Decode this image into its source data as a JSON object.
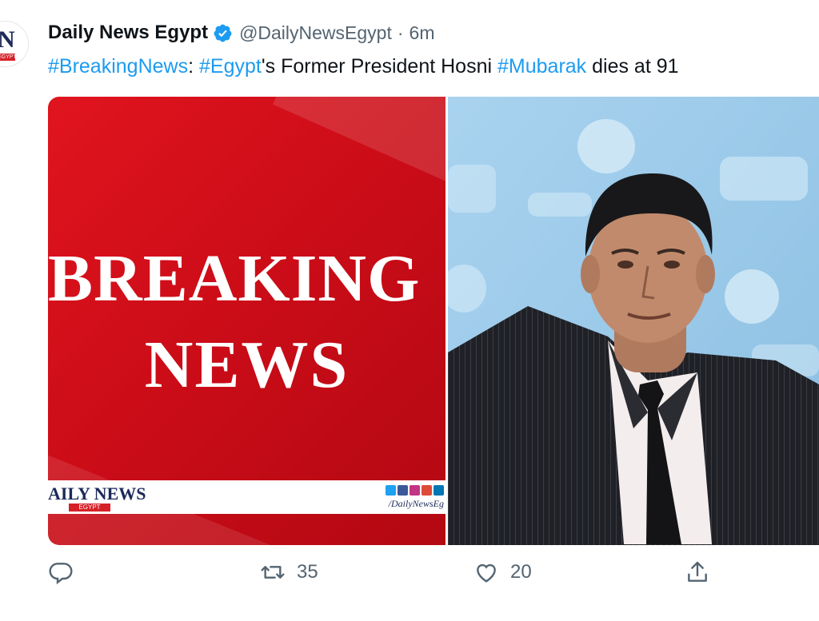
{
  "tweet": {
    "author_name": "Daily News Egypt",
    "handle": "@DailyNewsEgypt",
    "separator": "·",
    "time": "6m",
    "text": [
      {
        "text": "#BreakingNews",
        "hashtag": true
      },
      {
        "text": ": ",
        "hashtag": false
      },
      {
        "text": "#Egypt",
        "hashtag": true
      },
      {
        "text": "'s Former President Hosni ",
        "hashtag": false
      },
      {
        "text": "#Mubarak",
        "hashtag": true
      },
      {
        "text": " dies at 91",
        "hashtag": false
      }
    ]
  },
  "avatar": {
    "letter": "N",
    "strip": "EGYPT"
  },
  "media": {
    "left_image": {
      "line1": "BREAKING",
      "line2": "NEWS",
      "banner_name": "AILY NEWS",
      "banner_sub": "EGYPT",
      "banner_url": "/DailyNewsEg",
      "social_icons": [
        "twitter-icon",
        "facebook-icon",
        "instagram-icon",
        "googleplus-icon",
        "linkedin-icon"
      ]
    },
    "right_image": {
      "subject": "photo of Hosni Mubarak"
    }
  },
  "actions": {
    "reply": {
      "icon": "reply-icon",
      "count": ""
    },
    "retweet": {
      "icon": "retweet-icon",
      "count": "35"
    },
    "like": {
      "icon": "heart-icon",
      "count": "20"
    },
    "share": {
      "icon": "share-icon",
      "count": ""
    }
  },
  "colors": {
    "link": "#1d9bf0",
    "secondary": "#536471",
    "verified": "#1d9bf0",
    "breaking_red": "#d6121c",
    "photo_background": "#9ecae8"
  }
}
